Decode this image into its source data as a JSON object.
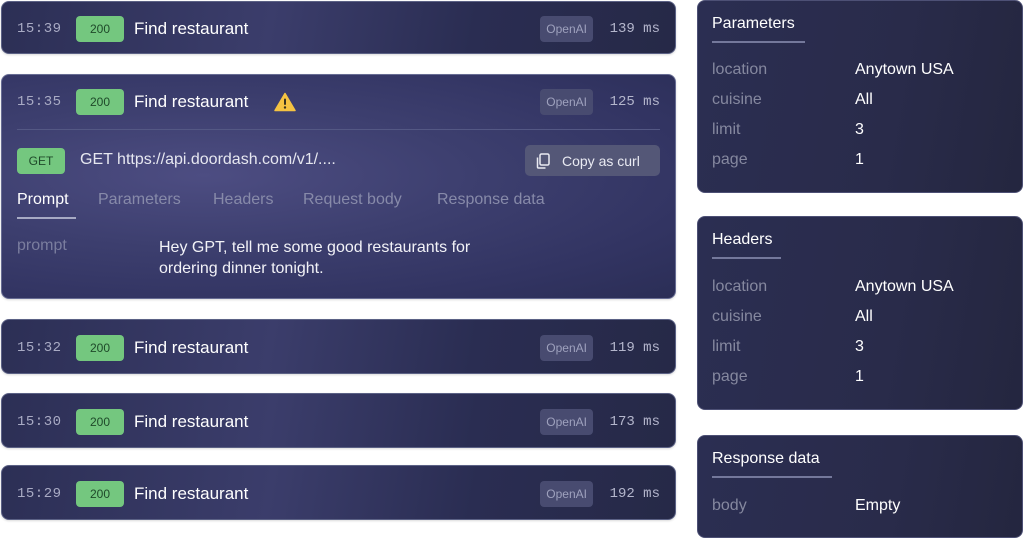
{
  "requests": [
    {
      "time": "15:39",
      "status": "200",
      "title": "Find restaurant",
      "provider": "OpenAI",
      "latency": "139 ms"
    },
    {
      "time": "15:35",
      "status": "200",
      "title": "Find restaurant",
      "provider": "OpenAI",
      "latency": "125 ms",
      "warning": true
    },
    {
      "time": "15:32",
      "status": "200",
      "title": "Find restaurant",
      "provider": "OpenAI",
      "latency": "119 ms"
    },
    {
      "time": "15:30",
      "status": "200",
      "title": "Find restaurant",
      "provider": "OpenAI",
      "latency": "173 ms"
    },
    {
      "time": "15:29",
      "status": "200",
      "title": "Find restaurant",
      "provider": "OpenAI",
      "latency": "192 ms"
    }
  ],
  "detail": {
    "method": "GET",
    "url": "GET https://api.doordash.com/v1/....",
    "copy_label": "Copy as curl",
    "tabs": [
      "Prompt",
      "Parameters",
      "Headers",
      "Request body",
      "Response data"
    ],
    "active_tab": "Prompt",
    "prompt_key": "prompt",
    "prompt_value": "Hey GPT, tell me some good restaurants for ordering dinner tonight."
  },
  "panels": {
    "parameters": {
      "title": "Parameters",
      "rows": [
        {
          "key": "location",
          "value": "Anytown USA"
        },
        {
          "key": "cuisine",
          "value": "All"
        },
        {
          "key": "limit",
          "value": "3"
        },
        {
          "key": "page",
          "value": "1"
        }
      ]
    },
    "headers": {
      "title": "Headers",
      "rows": [
        {
          "key": "location",
          "value": "Anytown USA"
        },
        {
          "key": "cuisine",
          "value": "All"
        },
        {
          "key": "limit",
          "value": "3"
        },
        {
          "key": "page",
          "value": "1"
        }
      ]
    },
    "response": {
      "title": "Response data",
      "rows": [
        {
          "key": "body",
          "value": "Empty"
        }
      ]
    }
  },
  "colors": {
    "status_ok": "#74c77f",
    "warning": "#f5c342",
    "card_bg": "#2c2f55"
  },
  "icons": {
    "warning": "warning-triangle-icon",
    "copy": "copy-icon"
  }
}
